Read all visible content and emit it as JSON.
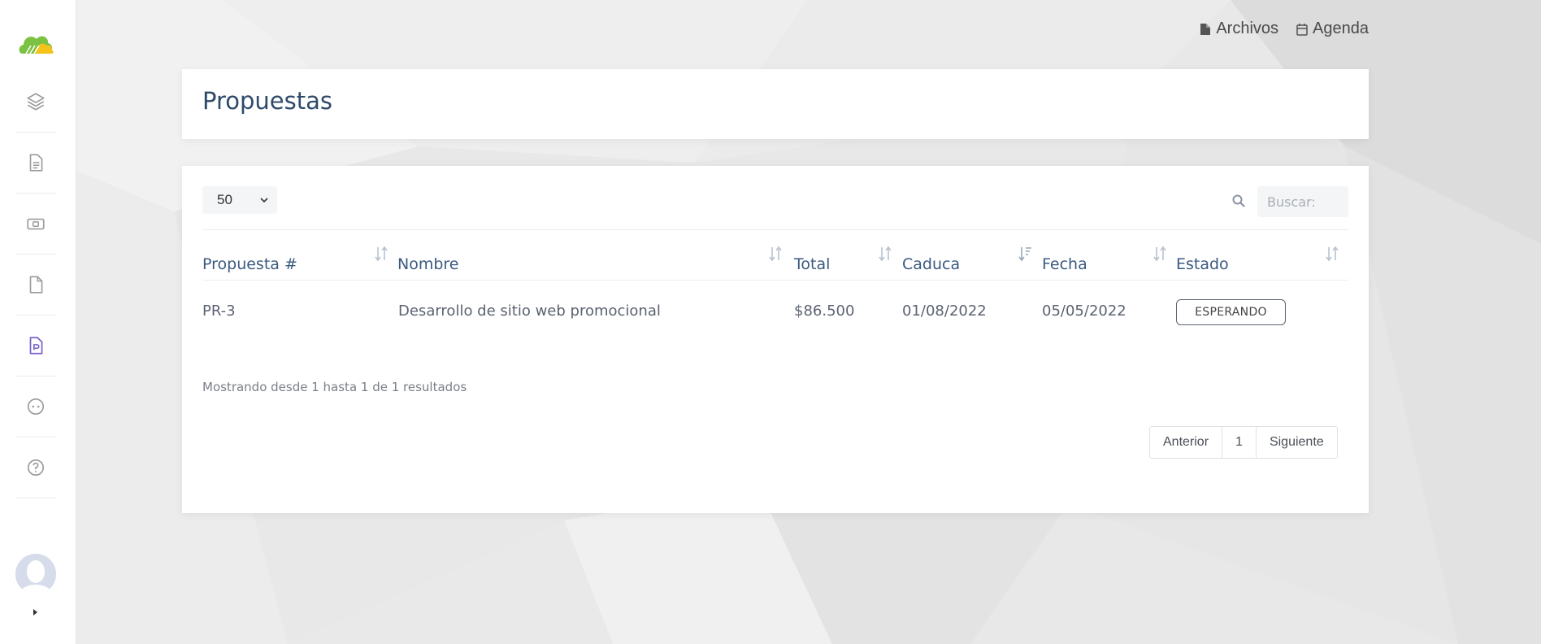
{
  "toplinks": {
    "archivos": "Archivos",
    "agenda": "Agenda"
  },
  "page": {
    "title": "Propuestas"
  },
  "table": {
    "length_value": "50",
    "search_placeholder": "Buscar:",
    "columns": [
      "Propuesta #",
      "Nombre",
      "Total",
      "Caduca",
      "Fecha",
      "Estado"
    ],
    "rows": [
      {
        "propuesta": "PR-3",
        "nombre": "Desarrollo de sitio web promocional",
        "total": "$86.500",
        "caduca": "01/08/2022",
        "fecha": "05/05/2022",
        "estado": "ESPERANDO"
      }
    ],
    "info": "Mostrando desde 1 hasta 1 de 1 resultados",
    "pagination": {
      "prev": "Anterior",
      "page": "1",
      "next": "Siguiente"
    }
  },
  "sidebar": {
    "icons": [
      "layers-icon",
      "document-icon",
      "money-icon",
      "file-icon",
      "proposal-icon",
      "chat-icon",
      "help-icon"
    ],
    "active_color": "#7b61c9"
  },
  "colors": {
    "heading": "#2f4a6b",
    "column_header": "#3b5a80"
  }
}
